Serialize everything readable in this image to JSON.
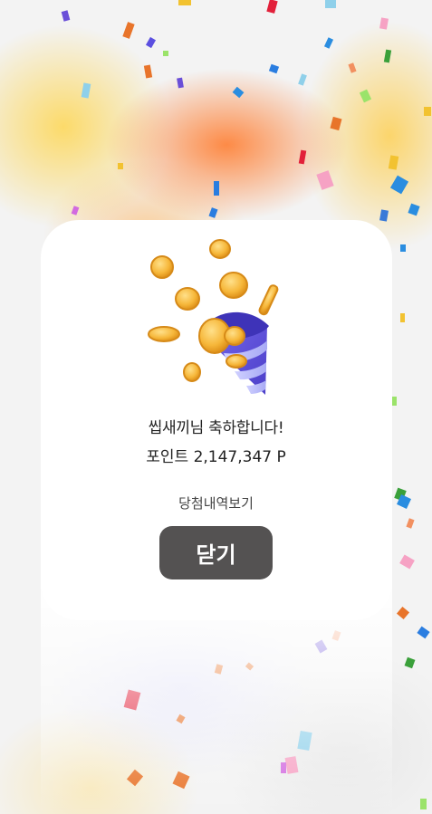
{
  "dialog": {
    "title": "씹새끼님 축하합니다!",
    "points": "포인트 2,147,347 P",
    "history_link": "당첨내역보기",
    "close_label": "닫기"
  },
  "icons": {
    "illustration": "party-popper-with-coins-icon",
    "decor": "confetti"
  },
  "colors": {
    "button_bg": "#545252",
    "button_text": "#ffffff",
    "card_bg": "#ffffff",
    "popper_purple": "#5b4fe0",
    "coin_gold": "#f4a825"
  }
}
